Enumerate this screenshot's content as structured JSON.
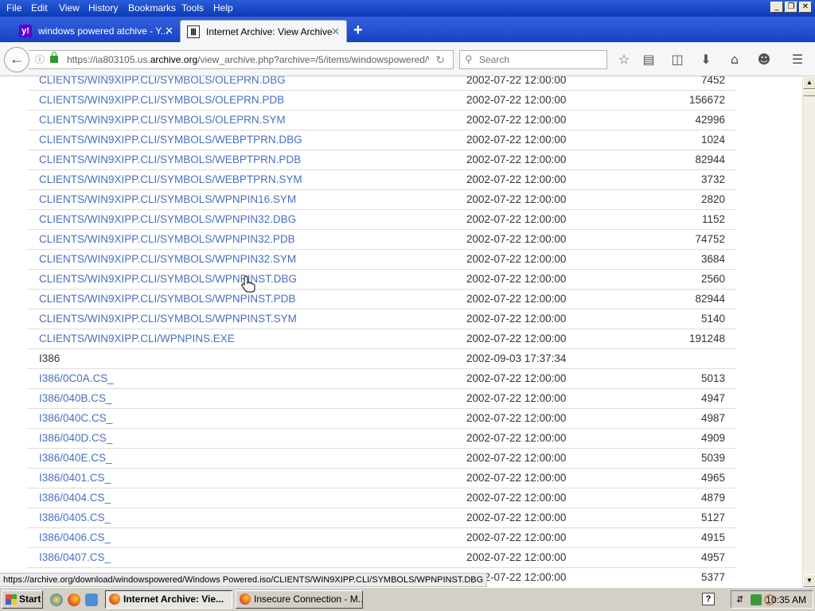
{
  "menubar": {
    "items": [
      {
        "label": "File"
      },
      {
        "label": "Edit"
      },
      {
        "label": "View"
      },
      {
        "label": "History"
      },
      {
        "label": "Bookmarks"
      },
      {
        "label": "Tools"
      },
      {
        "label": "Help"
      }
    ]
  },
  "tabs": [
    {
      "title": "windows powered atchive - Y..."
    },
    {
      "title": "Internet Archive: View Archive"
    }
  ],
  "navbar": {
    "url_prefix": "https://ia803105.us.",
    "url_domain": "archive.org",
    "url_suffix": "/view_archive.php?archive=/5/items/windowspowered/\\",
    "search_placeholder": "Search"
  },
  "files": [
    {
      "name": "CLIENTS/WIN9XIPP.CLI/SYMBOLS/OLEPRN.DBG",
      "date": "2002-07-22 12:00:00",
      "size": "7452",
      "link": true
    },
    {
      "name": "CLIENTS/WIN9XIPP.CLI/SYMBOLS/OLEPRN.PDB",
      "date": "2002-07-22 12:00:00",
      "size": "156672",
      "link": true
    },
    {
      "name": "CLIENTS/WIN9XIPP.CLI/SYMBOLS/OLEPRN.SYM",
      "date": "2002-07-22 12:00:00",
      "size": "42996",
      "link": true
    },
    {
      "name": "CLIENTS/WIN9XIPP.CLI/SYMBOLS/WEBPTPRN.DBG",
      "date": "2002-07-22 12:00:00",
      "size": "1024",
      "link": true
    },
    {
      "name": "CLIENTS/WIN9XIPP.CLI/SYMBOLS/WEBPTPRN.PDB",
      "date": "2002-07-22 12:00:00",
      "size": "82944",
      "link": true
    },
    {
      "name": "CLIENTS/WIN9XIPP.CLI/SYMBOLS/WEBPTPRN.SYM",
      "date": "2002-07-22 12:00:00",
      "size": "3732",
      "link": true
    },
    {
      "name": "CLIENTS/WIN9XIPP.CLI/SYMBOLS/WPNPIN16.SYM",
      "date": "2002-07-22 12:00:00",
      "size": "2820",
      "link": true
    },
    {
      "name": "CLIENTS/WIN9XIPP.CLI/SYMBOLS/WPNPIN32.DBG",
      "date": "2002-07-22 12:00:00",
      "size": "1152",
      "link": true
    },
    {
      "name": "CLIENTS/WIN9XIPP.CLI/SYMBOLS/WPNPIN32.PDB",
      "date": "2002-07-22 12:00:00",
      "size": "74752",
      "link": true
    },
    {
      "name": "CLIENTS/WIN9XIPP.CLI/SYMBOLS/WPNPIN32.SYM",
      "date": "2002-07-22 12:00:00",
      "size": "3684",
      "link": true
    },
    {
      "name": "CLIENTS/WIN9XIPP.CLI/SYMBOLS/WPNPINST.DBG",
      "date": "2002-07-22 12:00:00",
      "size": "2560",
      "link": true
    },
    {
      "name": "CLIENTS/WIN9XIPP.CLI/SYMBOLS/WPNPINST.PDB",
      "date": "2002-07-22 12:00:00",
      "size": "82944",
      "link": true
    },
    {
      "name": "CLIENTS/WIN9XIPP.CLI/SYMBOLS/WPNPINST.SYM",
      "date": "2002-07-22 12:00:00",
      "size": "5140",
      "link": true
    },
    {
      "name": "CLIENTS/WIN9XIPP.CLI/WPNPINS.EXE",
      "date": "2002-07-22 12:00:00",
      "size": "191248",
      "link": true
    },
    {
      "name": "I386",
      "date": "2002-09-03 17:37:34",
      "size": "",
      "link": false
    },
    {
      "name": "I386/0C0A.CS_",
      "date": "2002-07-22 12:00:00",
      "size": "5013",
      "link": true
    },
    {
      "name": "I386/040B.CS_",
      "date": "2002-07-22 12:00:00",
      "size": "4947",
      "link": true
    },
    {
      "name": "I386/040C.CS_",
      "date": "2002-07-22 12:00:00",
      "size": "4987",
      "link": true
    },
    {
      "name": "I386/040D.CS_",
      "date": "2002-07-22 12:00:00",
      "size": "4909",
      "link": true
    },
    {
      "name": "I386/040E.CS_",
      "date": "2002-07-22 12:00:00",
      "size": "5039",
      "link": true
    },
    {
      "name": "I386/0401.CS_",
      "date": "2002-07-22 12:00:00",
      "size": "4965",
      "link": true
    },
    {
      "name": "I386/0404.CS_",
      "date": "2002-07-22 12:00:00",
      "size": "4879",
      "link": true
    },
    {
      "name": "I386/0405.CS_",
      "date": "2002-07-22 12:00:00",
      "size": "5127",
      "link": true
    },
    {
      "name": "I386/0406.CS_",
      "date": "2002-07-22 12:00:00",
      "size": "4915",
      "link": true
    },
    {
      "name": "I386/0407.CS_",
      "date": "2002-07-22 12:00:00",
      "size": "4957",
      "link": true
    },
    {
      "name": "",
      "date": "2002-07-22 12:00:00",
      "size": "5377",
      "link": true
    }
  ],
  "statusbar": {
    "link_preview": "https://archive.org/download/windowspowered/Windows Powered.iso/CLIENTS/WIN9XIPP.CLI/SYMBOLS/WPNPINST.DBG"
  },
  "taskbar": {
    "start_label": "Start",
    "buttons": [
      {
        "label": "Internet Archive: Vie..."
      },
      {
        "label": "Insecure Connection - M..."
      }
    ],
    "clock": "10:35 AM"
  },
  "colors": {
    "link": "#4a6fc0",
    "titlebar": "#0c3ab8",
    "taskbar": "#d4d0c8"
  },
  "icons": {
    "bookmark": "star-icon",
    "reading_list": "reading-list-icon",
    "pocket": "pocket-icon",
    "downloads": "download-icon",
    "home": "home-icon",
    "account": "smiley-icon",
    "menu": "hamburger-menu-icon"
  }
}
